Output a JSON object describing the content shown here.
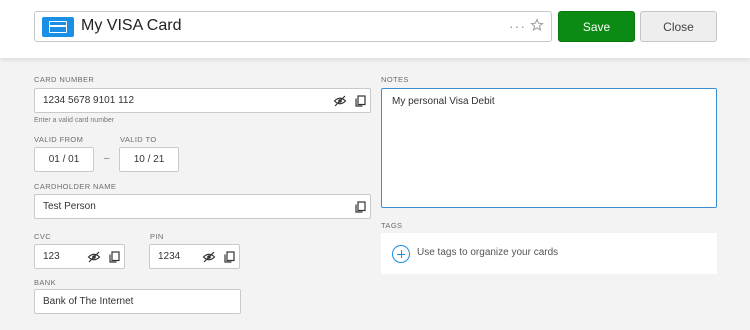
{
  "header": {
    "title": "My VISA Card",
    "more_glyph": "···",
    "save_label": "Save",
    "close_label": "Close",
    "accent": "#1a8fe6",
    "save_color": "#0b8a14"
  },
  "left": {
    "card_number": {
      "label": "CARD NUMBER",
      "value": "1234 5678 9101 112",
      "hint": "Enter a valid card number"
    },
    "valid_from": {
      "label": "VALID FROM",
      "value": "01 / 01"
    },
    "valid_to": {
      "label": "VALID TO",
      "value": "10 / 21"
    },
    "date_separator": "–",
    "cardholder": {
      "label": "CARDHOLDER NAME",
      "value": "Test Person"
    },
    "cvc": {
      "label": "CVC",
      "value": "123"
    },
    "pin": {
      "label": "PIN",
      "value": "1234"
    },
    "bank": {
      "label": "BANK",
      "value": "Bank of The Internet"
    }
  },
  "right": {
    "notes": {
      "label": "NOTES",
      "value": "My personal Visa Debit"
    },
    "tags": {
      "label": "TAGS",
      "placeholder": "Use tags to organize your cards"
    }
  },
  "icons": {
    "card": "credit-card-icon",
    "star": "star-icon",
    "hide": "eye-slash-icon",
    "copy": "copy-icon",
    "add": "plus-circle-icon"
  }
}
